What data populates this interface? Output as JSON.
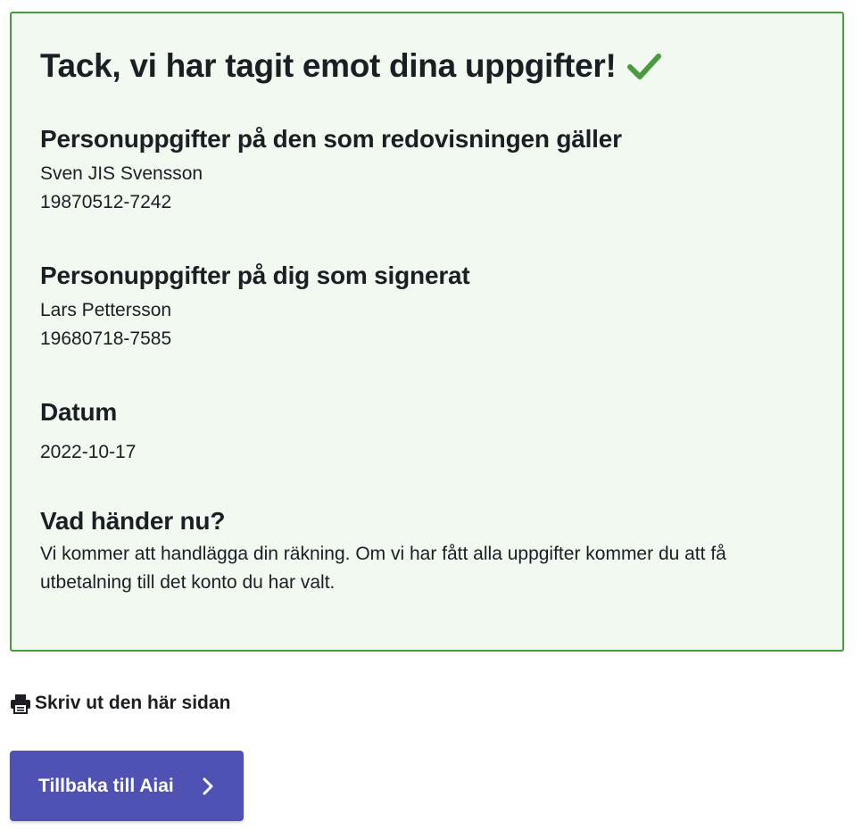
{
  "confirmation": {
    "title": "Tack, vi har tagit emot dina uppgifter!",
    "success_icon": "checkmark-icon",
    "success_color": "#4a9b3f",
    "border_color": "#4a9b3f",
    "background_color": "#f1f9f1"
  },
  "subject": {
    "heading": "Personuppgifter på den som redovisningen gäller",
    "name": "Sven JIS Svensson",
    "personal_number": "19870512-7242"
  },
  "signer": {
    "heading": "Personuppgifter på dig som signerat",
    "name": "Lars Pettersson",
    "personal_number": "19680718-7585"
  },
  "date": {
    "heading": "Datum",
    "value": "2022-10-17"
  },
  "next_steps": {
    "heading": "Vad händer nu?",
    "line_1": "Vi kommer att handlägga din räkning. Om vi har fått alla uppgifter kommer du att få",
    "line_2": "utbetalning till det konto du har valt."
  },
  "actions": {
    "print_label": "Skriv ut den här sidan",
    "print_icon": "printer-icon",
    "back_label": "Tillbaka till Aiai",
    "back_icon": "chevron-right-icon",
    "button_color": "#4f52b2"
  }
}
